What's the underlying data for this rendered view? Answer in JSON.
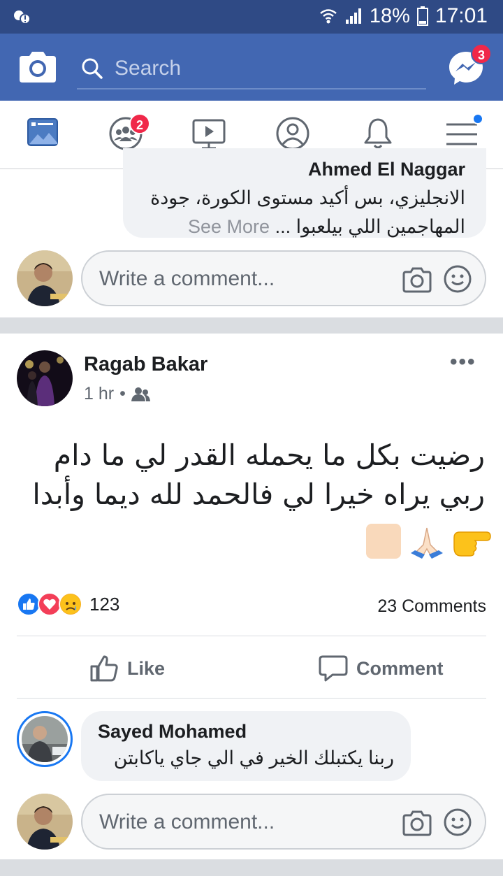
{
  "status_bar": {
    "battery": "18%",
    "time": "17:01"
  },
  "header": {
    "search_placeholder": "Search",
    "messenger_badge": "3"
  },
  "nav": {
    "groups_badge": "2",
    "tabs": [
      "news-feed",
      "groups",
      "watch",
      "profile",
      "notifications",
      "menu"
    ]
  },
  "previous_post": {
    "comment_line_0": "Ahmed El Naggar",
    "comment_line_1": "الانجليزي، بس أكيد مستوى الكورة، جودة",
    "comment_line_2": "المهاجمين اللي بيلعبوا ...",
    "see_more": "See More",
    "write_comment_placeholder": "Write a comment..."
  },
  "post": {
    "author": "Ragab Bakar",
    "time": "1 hr",
    "audience_icon": "friends-icon",
    "text": "رضيت بكل ما يحمله القدر لي ما دام ربي يراه خيرا لي فالحمد لله ديما وأبدا",
    "emoji": [
      "👉",
      "🙏",
      "⬜"
    ],
    "reactions": [
      "like",
      "love",
      "sad"
    ],
    "reaction_count": "123",
    "comments_count": "23 Comments",
    "like_label": "Like",
    "comment_label": "Comment",
    "comment": {
      "author": "Sayed Mohamed",
      "text": "ربنا يكتبلك الخير في الي جاي ياكابتن"
    },
    "write_comment_placeholder": "Write a comment..."
  },
  "colors": {
    "brand_blue": "#4267b2",
    "status_bar": "#2f4a85",
    "badge_red": "#f02849",
    "link_blue": "#1877f2"
  }
}
